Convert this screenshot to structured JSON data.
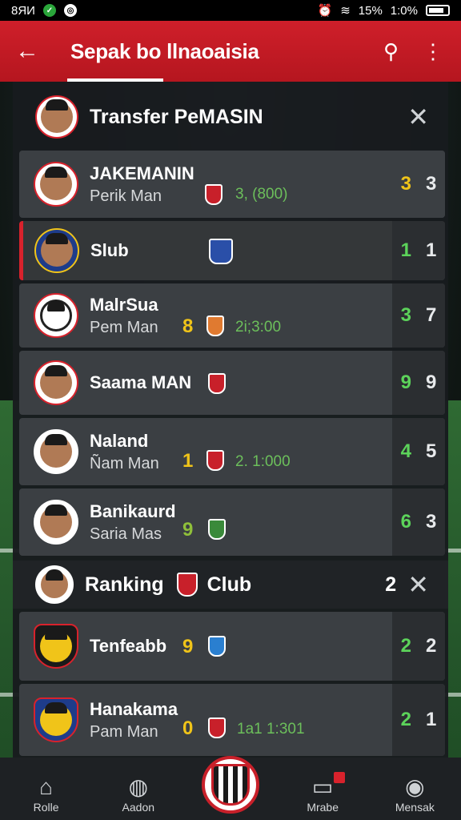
{
  "status": {
    "left": "8ЯИ",
    "right": "1:0%",
    "battery": "1:0%",
    "signal": "15%"
  },
  "appbar": {
    "title": "Sepak bo llnaoaisia"
  },
  "transfer": {
    "title": "Transfer PeMASIN"
  },
  "rows": [
    {
      "name": "JAKEMANIN",
      "sub": "Perik Man",
      "fee": "3, (800)",
      "score1": "3",
      "score2": "3"
    },
    {
      "name": "Slub",
      "sub": "",
      "fee": "",
      "score1": "1",
      "score2": "1"
    },
    {
      "name": "MalrSua",
      "sub": "Pem Man",
      "num": "8",
      "fee": "2i;3:00",
      "score1": "3",
      "score2": "7"
    },
    {
      "name": "Saama MAN",
      "sub": "",
      "fee": "",
      "score1": "9",
      "score2": "9"
    },
    {
      "name": "Naland",
      "sub": "Ñam Man",
      "num": "1",
      "fee": "2. 1:000",
      "score1": "4",
      "score2": "5"
    },
    {
      "name": "Banikaurd",
      "sub": "Saria Mas",
      "num": "9",
      "fee": "",
      "score1": "6",
      "score2": "3"
    }
  ],
  "ranking": {
    "left": "Ranking",
    "right": "Club",
    "count": "2"
  },
  "ranking_rows": [
    {
      "name": "Tenfeabb",
      "num": "9",
      "score1": "2",
      "score2": "2"
    },
    {
      "name": "Hanakama",
      "sub": "Pam Man",
      "num": "0",
      "fee": "1a1 1:301",
      "score1": "2",
      "score2": "1"
    }
  ],
  "nav": [
    {
      "label": "Rolle"
    },
    {
      "label": "Aadon"
    },
    {
      "label": "Mrabe"
    },
    {
      "label": "Mensak"
    }
  ]
}
